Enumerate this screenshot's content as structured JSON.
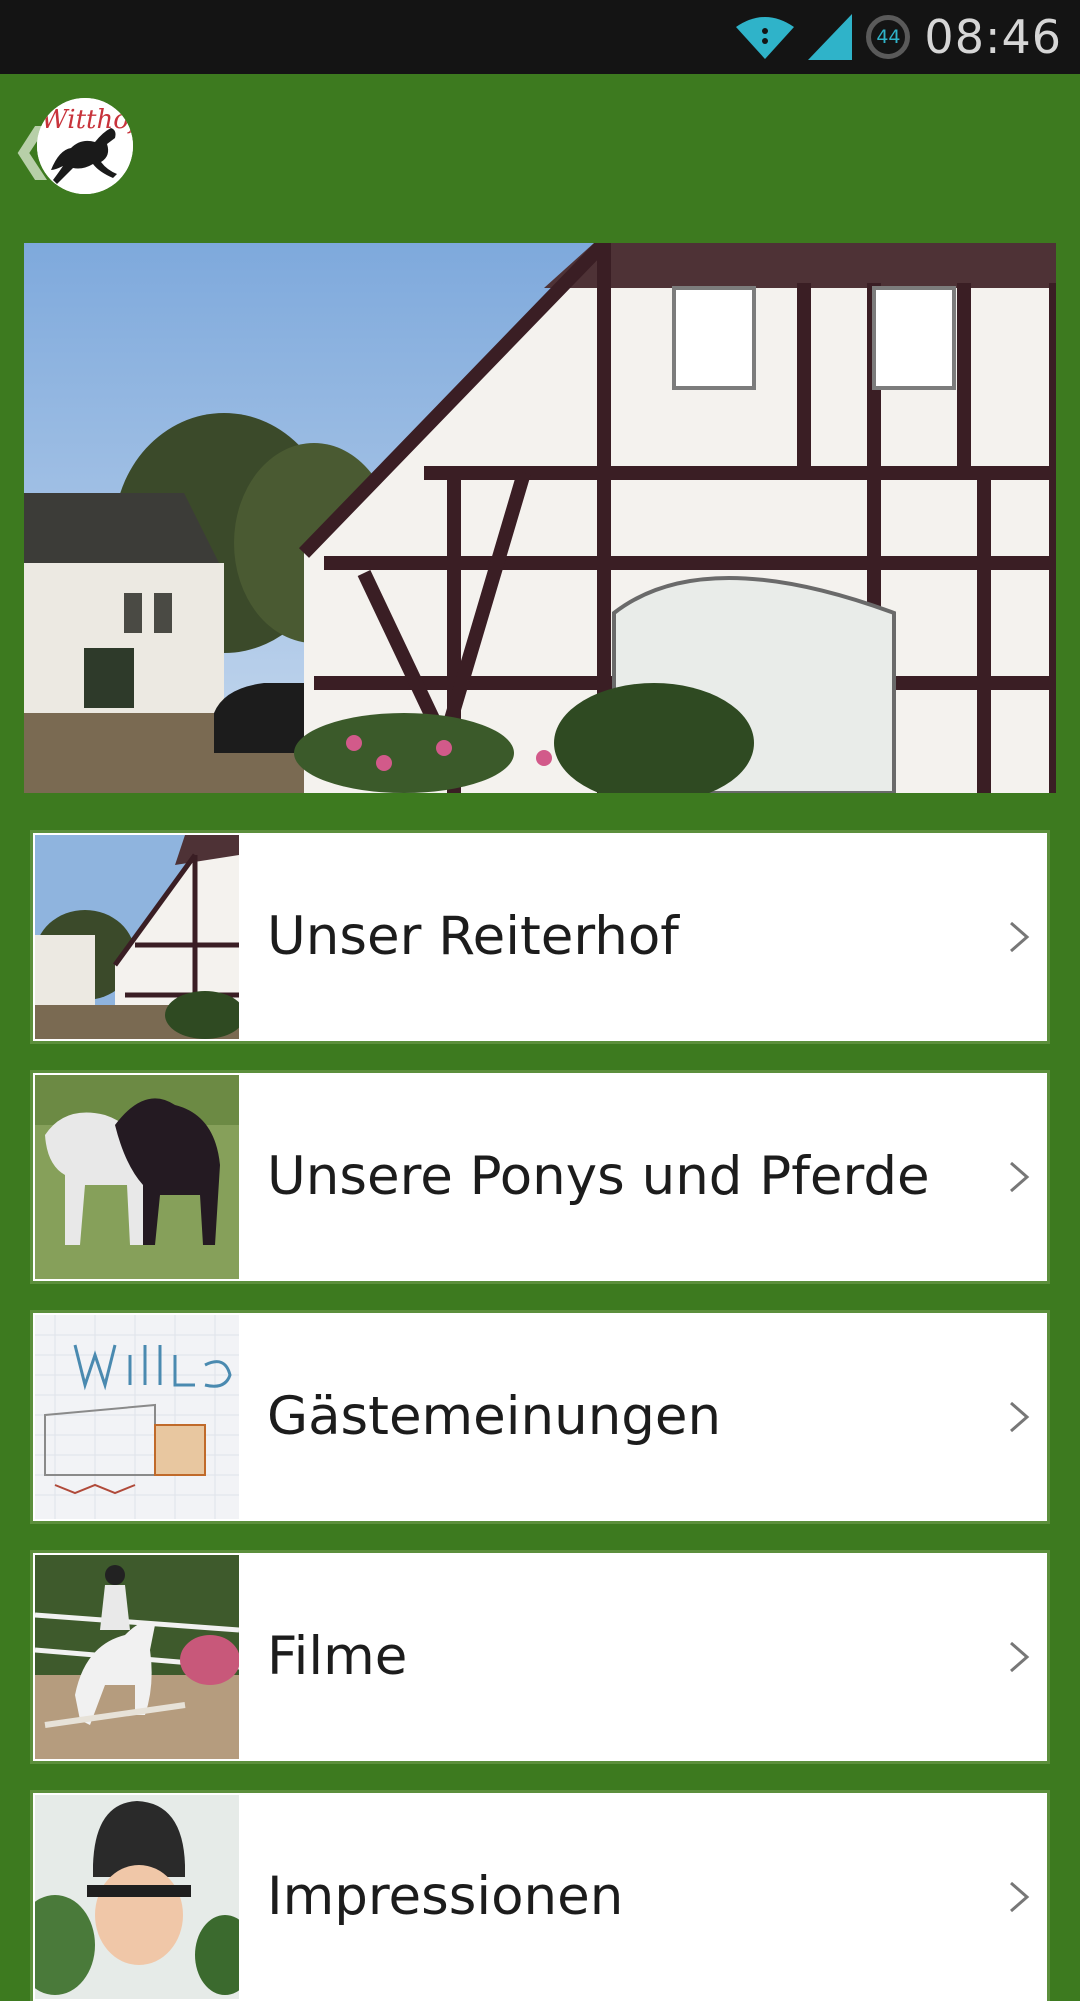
{
  "status_bar": {
    "time": "08:46",
    "battery_level": "44",
    "icons": [
      "wifi-icon",
      "signal-icon",
      "battery-icon"
    ]
  },
  "app_bar": {
    "logo_text": "Witthof",
    "back_icon": "chevron-left-icon"
  },
  "menu": {
    "items": [
      {
        "label": "Unser Reiterhof",
        "thumb": "farmhouse"
      },
      {
        "label": "Unsere Ponys und Pferde",
        "thumb": "horses"
      },
      {
        "label": "Gästemeinungen",
        "thumb": "drawing"
      },
      {
        "label": "Filme",
        "thumb": "jumping-rider"
      },
      {
        "label": "Impressionen",
        "thumb": "rider-portrait"
      }
    ]
  },
  "colors": {
    "background": "#3d7a1f",
    "status_bar": "#141414",
    "item_background": "#ffffff",
    "text": "#1c1c1c"
  }
}
